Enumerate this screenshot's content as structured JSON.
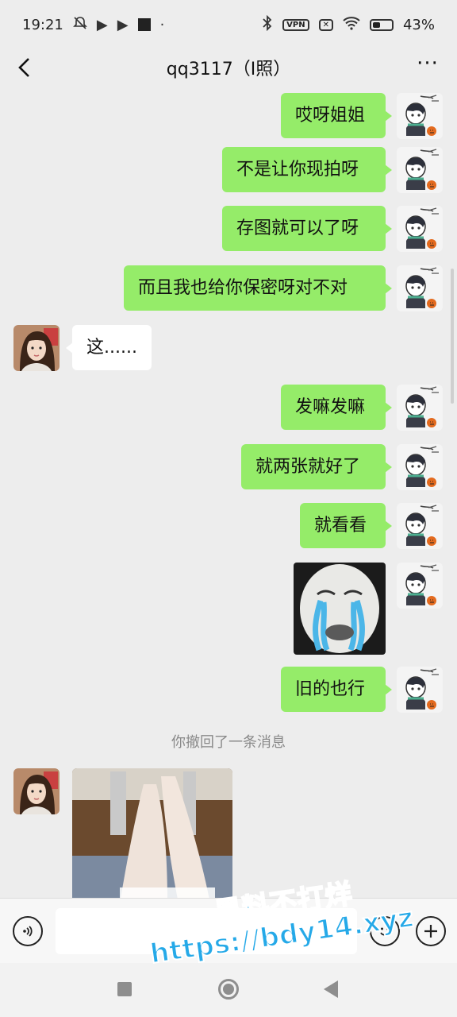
{
  "status_bar": {
    "time": "19:21",
    "vpn_label": "VPN",
    "battery_percent": "43%",
    "battery_level": 0.43
  },
  "header": {
    "title": "qq3117（I照）",
    "more_label": "···"
  },
  "messages": [
    {
      "side": "me",
      "text": "哎呀姐姐"
    },
    {
      "side": "me",
      "text": "不是让你现拍呀"
    },
    {
      "side": "me",
      "text": "存图就可以了呀"
    },
    {
      "side": "me",
      "text": "而且我也给你保密呀对不对"
    },
    {
      "side": "them",
      "text": "这......"
    },
    {
      "side": "me",
      "text": "发嘛发嘛"
    },
    {
      "side": "me",
      "text": "就两张就好了"
    },
    {
      "side": "me",
      "text": "就看看"
    },
    {
      "side": "me",
      "type": "sticker",
      "text": ""
    },
    {
      "side": "me",
      "text": "旧的也行"
    },
    {
      "type": "system",
      "text": "你撤回了一条消息"
    },
    {
      "side": "them",
      "type": "photo",
      "text": ""
    }
  ],
  "watermark": {
    "line1": "黑料不打烊",
    "line2": "https://bdy14.xyz"
  },
  "colors": {
    "my_bubble": "#95ec69",
    "their_bubble": "#ffffff",
    "background": "#ededed",
    "watermark": "#25a9e8"
  }
}
